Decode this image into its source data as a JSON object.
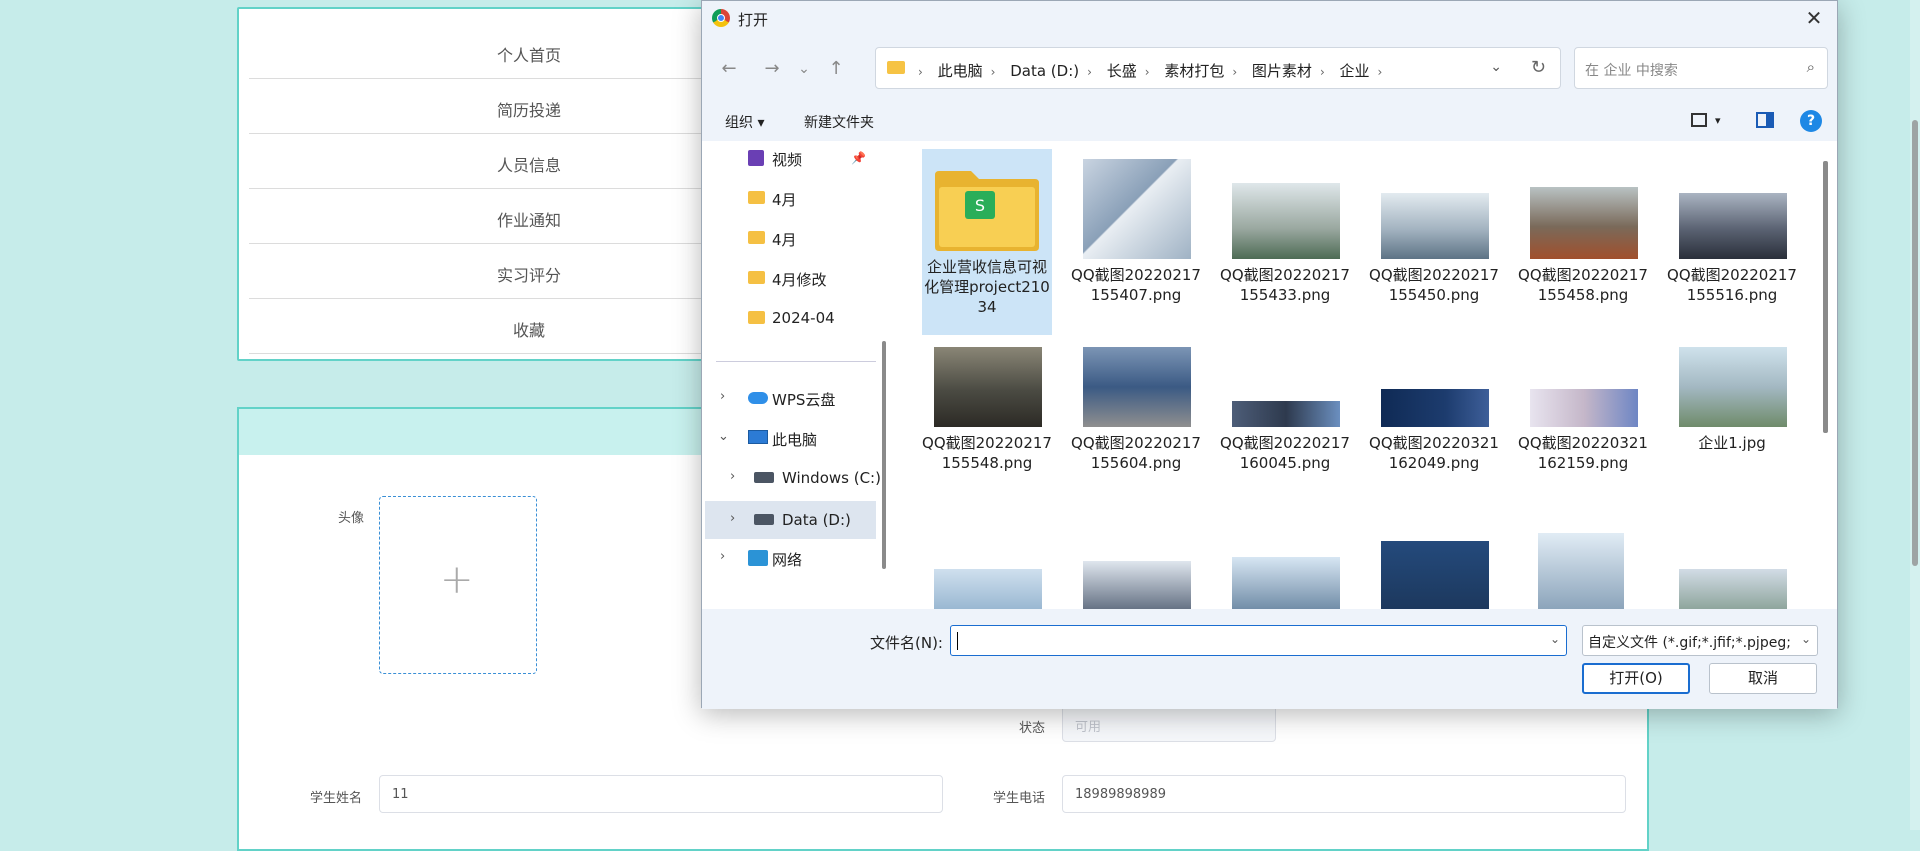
{
  "bg": {
    "menu": [
      "个人首页",
      "简历投递",
      "人员信息",
      "作业通知",
      "实习评分",
      "收藏"
    ],
    "form": {
      "avatar_label": "头像",
      "status_label": "状态",
      "status_value": "可用",
      "name_label": "学生姓名",
      "name_value": "11",
      "phone_label": "学生电话",
      "phone_value": "18989898989"
    }
  },
  "dialog": {
    "title": "打开",
    "close": "✕",
    "nav": {
      "back": "←",
      "forward": "→",
      "recent": "⌄",
      "up": "↑"
    },
    "breadcrumbs": [
      "此电脑",
      "Data (D:)",
      "长盛",
      "素材打包",
      "图片素材",
      "企业"
    ],
    "search_placeholder": "在 企业 中搜索",
    "toolbar": {
      "organize": "组织 ▾",
      "new_folder": "新建文件夹",
      "help": "?"
    },
    "nav_items": [
      "视频",
      "4月",
      "4月",
      "4月修改",
      "2024-04",
      "WPS云盘",
      "此电脑",
      "Windows (C:)",
      "Data (D:)",
      "网络"
    ],
    "files": [
      {
        "name": "企业营收信息可视化管理project21034",
        "type": "folder"
      },
      {
        "name": "QQ截图20220217155407.png",
        "color": "#8aa0b8"
      },
      {
        "name": "QQ截图20220217155433.png",
        "color": "#9aa8a0"
      },
      {
        "name": "QQ截图20220217155450.png",
        "color": "#a3b3c0"
      },
      {
        "name": "QQ截图20220217155458.png",
        "color": "#7a6a5a"
      },
      {
        "name": "QQ截图20220217155516.png",
        "color": "#5a6272"
      },
      {
        "name": "QQ截图20220217155548.png",
        "color": "#4a4a42"
      },
      {
        "name": "QQ截图20220217155604.png",
        "color": "#3b5a84"
      },
      {
        "name": "QQ截图20220217160045.png",
        "color": "#2e3a4e"
      },
      {
        "name": "QQ截图20220321162049.png",
        "color": "#1d3c6e"
      },
      {
        "name": "QQ截图20220321162159.png",
        "color": "#c5b7c9"
      },
      {
        "name": "企业1.jpg",
        "color": "#a3b8c2"
      }
    ],
    "filename_label": "文件名(N):",
    "filename_value": "",
    "filter": "自定义文件 (*.gif;*.jfif;*.pjpeg;",
    "open_button": "打开(O)",
    "cancel_button": "取消"
  }
}
